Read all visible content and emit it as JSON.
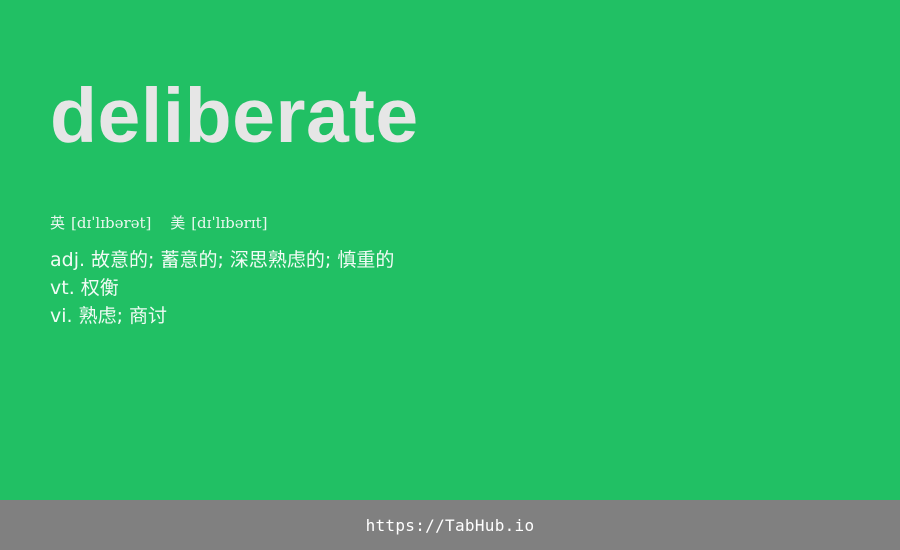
{
  "word": "deliberate",
  "phonetics": {
    "uk": {
      "label": "英",
      "ipa": "[dɪˈlɪbərət]"
    },
    "us": {
      "label": "美",
      "ipa": "[dɪˈlɪbərɪt]"
    }
  },
  "definitions": [
    {
      "pos": "adj.",
      "meaning": "故意的; 蓄意的; 深思熟虑的; 慎重的"
    },
    {
      "pos": "vt.",
      "meaning": "权衡"
    },
    {
      "pos": "vi.",
      "meaning": "熟虑; 商讨"
    }
  ],
  "footer": {
    "link_text": "https://TabHub.io"
  },
  "colors": {
    "background": "#21c064",
    "word_text": "#e6e6e6",
    "footer_background": "#808080",
    "footer_text": "#ffffff"
  }
}
